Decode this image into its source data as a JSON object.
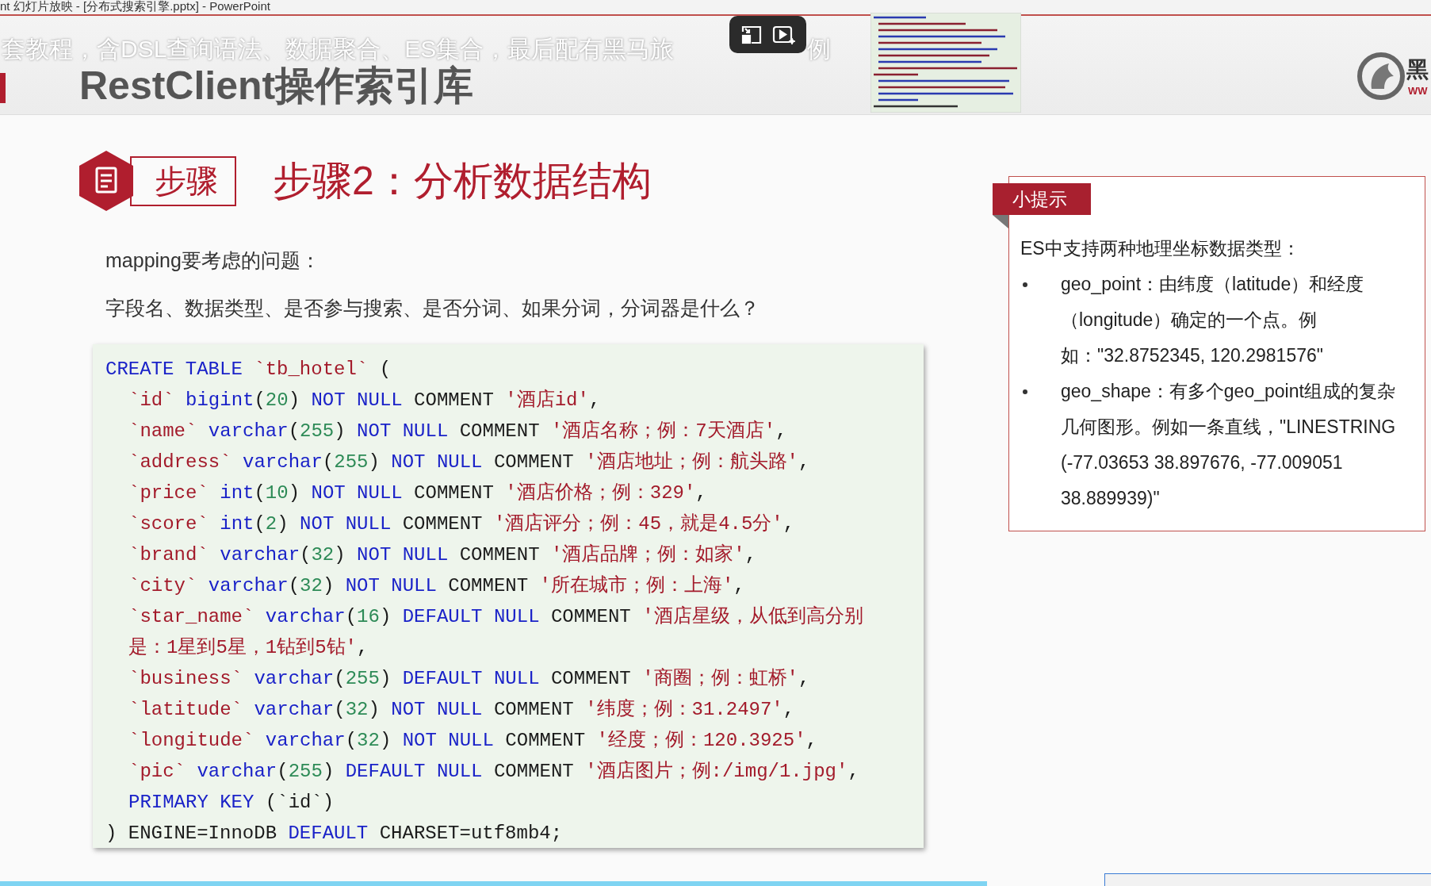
{
  "window": {
    "title": "nt 幻灯片放映 - [分布式搜索引擎.pptx] - PowerPoint"
  },
  "video_overlay": {
    "subtitle_before": "套教程，含DSL查询语法、数据聚合、ES集合，最后配有黑马旅",
    "subtitle_after": "例",
    "buttons": [
      {
        "kind": "pip"
      },
      {
        "kind": "play"
      }
    ]
  },
  "slide": {
    "title": "RestClient操作索引库",
    "logo_text": "黑",
    "logo_url": "WW",
    "step_label": "步骤",
    "heading": "步骤2：分析数据结构",
    "paragraphs": [
      "mapping要考虑的问题：",
      "字段名、数据类型、是否参与搜索、是否分词、如果分词，分词器是什么？"
    ],
    "code": [
      {
        "indent": false,
        "tokens": [
          {
            "kind": "kw",
            "text": "CREATE TABLE "
          },
          {
            "kind": "id",
            "text": "`tb_hotel`"
          },
          {
            "kind": "plain",
            "text": " ("
          }
        ]
      },
      {
        "indent": true,
        "tokens": [
          {
            "kind": "id",
            "text": "`id`"
          },
          {
            "kind": "kw",
            "text": "bigint"
          },
          {
            "kind": "plain",
            "text": "("
          },
          {
            "kind": "num",
            "text": "20"
          },
          {
            "kind": "plain",
            "text": ") "
          },
          {
            "kind": "kw",
            "text": "NOT NULL"
          },
          {
            "kind": "plain",
            "text": " COMMENT "
          },
          {
            "kind": "str",
            "text": "'酒店id'"
          },
          {
            "kind": "plain",
            "text": ","
          }
        ]
      },
      {
        "indent": true,
        "tokens": [
          {
            "kind": "id",
            "text": "`name`"
          },
          {
            "kind": "kw",
            "text": "varchar"
          },
          {
            "kind": "plain",
            "text": "("
          },
          {
            "kind": "num",
            "text": "255"
          },
          {
            "kind": "plain",
            "text": ") "
          },
          {
            "kind": "kw",
            "text": "NOT NULL"
          },
          {
            "kind": "plain",
            "text": " COMMENT "
          },
          {
            "kind": "str",
            "text": "'酒店名称；例：7天酒店'"
          },
          {
            "kind": "plain",
            "text": ","
          }
        ]
      },
      {
        "indent": true,
        "tokens": [
          {
            "kind": "id",
            "text": "`address`"
          },
          {
            "kind": "kw",
            "text": "varchar"
          },
          {
            "kind": "plain",
            "text": "("
          },
          {
            "kind": "num",
            "text": "255"
          },
          {
            "kind": "plain",
            "text": ") "
          },
          {
            "kind": "kw",
            "text": "NOT NULL"
          },
          {
            "kind": "plain",
            "text": " COMMENT "
          },
          {
            "kind": "str",
            "text": "'酒店地址；例：航头路'"
          },
          {
            "kind": "plain",
            "text": ","
          }
        ]
      },
      {
        "indent": true,
        "tokens": [
          {
            "kind": "id",
            "text": "`price`"
          },
          {
            "kind": "kw",
            "text": "int"
          },
          {
            "kind": "plain",
            "text": "("
          },
          {
            "kind": "num",
            "text": "10"
          },
          {
            "kind": "plain",
            "text": ") "
          },
          {
            "kind": "kw",
            "text": "NOT NULL"
          },
          {
            "kind": "plain",
            "text": " COMMENT "
          },
          {
            "kind": "str",
            "text": "'酒店价格；例：329'"
          },
          {
            "kind": "plain",
            "text": ","
          }
        ]
      },
      {
        "indent": true,
        "tokens": [
          {
            "kind": "id",
            "text": "`score`"
          },
          {
            "kind": "kw",
            "text": "int"
          },
          {
            "kind": "plain",
            "text": "("
          },
          {
            "kind": "num",
            "text": "2"
          },
          {
            "kind": "plain",
            "text": ") "
          },
          {
            "kind": "kw",
            "text": "NOT NULL"
          },
          {
            "kind": "plain",
            "text": " COMMENT "
          },
          {
            "kind": "str",
            "text": "'酒店评分；例：45，就是4.5分'"
          },
          {
            "kind": "plain",
            "text": ","
          }
        ]
      },
      {
        "indent": true,
        "tokens": [
          {
            "kind": "id",
            "text": "`brand`"
          },
          {
            "kind": "kw",
            "text": "varchar"
          },
          {
            "kind": "plain",
            "text": "("
          },
          {
            "kind": "num",
            "text": "32"
          },
          {
            "kind": "plain",
            "text": ") "
          },
          {
            "kind": "kw",
            "text": "NOT NULL"
          },
          {
            "kind": "plain",
            "text": " COMMENT "
          },
          {
            "kind": "str",
            "text": "'酒店品牌；例：如家'"
          },
          {
            "kind": "plain",
            "text": ","
          }
        ]
      },
      {
        "indent": true,
        "tokens": [
          {
            "kind": "id",
            "text": "`city`"
          },
          {
            "kind": "kw",
            "text": "varchar"
          },
          {
            "kind": "plain",
            "text": "("
          },
          {
            "kind": "num",
            "text": "32"
          },
          {
            "kind": "plain",
            "text": ") "
          },
          {
            "kind": "kw",
            "text": "NOT NULL"
          },
          {
            "kind": "plain",
            "text": " COMMENT "
          },
          {
            "kind": "str",
            "text": "'所在城市；例：上海'"
          },
          {
            "kind": "plain",
            "text": ","
          }
        ]
      },
      {
        "indent": true,
        "tokens": [
          {
            "kind": "id",
            "text": "`star_name`"
          },
          {
            "kind": "kw",
            "text": "varchar"
          },
          {
            "kind": "plain",
            "text": "("
          },
          {
            "kind": "num",
            "text": "16"
          },
          {
            "kind": "plain",
            "text": ") "
          },
          {
            "kind": "kw",
            "text": "DEFAULT NULL"
          },
          {
            "kind": "plain",
            "text": " COMMENT "
          },
          {
            "kind": "str",
            "text": "'酒店星级，从低到高分别是：1星到5星，1钻到5钻'"
          },
          {
            "kind": "plain",
            "text": ","
          }
        ]
      },
      {
        "indent": true,
        "tokens": [
          {
            "kind": "id",
            "text": "`business`"
          },
          {
            "kind": "kw",
            "text": "varchar"
          },
          {
            "kind": "plain",
            "text": "("
          },
          {
            "kind": "num",
            "text": "255"
          },
          {
            "kind": "plain",
            "text": ") "
          },
          {
            "kind": "kw",
            "text": "DEFAULT NULL"
          },
          {
            "kind": "plain",
            "text": " COMMENT "
          },
          {
            "kind": "str",
            "text": "'商圈；例：虹桥'"
          },
          {
            "kind": "plain",
            "text": ","
          }
        ]
      },
      {
        "indent": true,
        "tokens": [
          {
            "kind": "id",
            "text": "`latitude`"
          },
          {
            "kind": "kw",
            "text": "varchar"
          },
          {
            "kind": "plain",
            "text": "("
          },
          {
            "kind": "num",
            "text": "32"
          },
          {
            "kind": "plain",
            "text": ") "
          },
          {
            "kind": "kw",
            "text": "NOT NULL"
          },
          {
            "kind": "plain",
            "text": " COMMENT "
          },
          {
            "kind": "str",
            "text": "'纬度；例：31.2497'"
          },
          {
            "kind": "plain",
            "text": ","
          }
        ]
      },
      {
        "indent": true,
        "tokens": [
          {
            "kind": "id",
            "text": "`longitude`"
          },
          {
            "kind": "kw",
            "text": "varchar"
          },
          {
            "kind": "plain",
            "text": "("
          },
          {
            "kind": "num",
            "text": "32"
          },
          {
            "kind": "plain",
            "text": ") "
          },
          {
            "kind": "kw",
            "text": "NOT NULL"
          },
          {
            "kind": "plain",
            "text": " COMMENT "
          },
          {
            "kind": "str",
            "text": "'经度；例：120.3925'"
          },
          {
            "kind": "plain",
            "text": ","
          }
        ]
      },
      {
        "indent": true,
        "tokens": [
          {
            "kind": "id",
            "text": "`pic`"
          },
          {
            "kind": "kw",
            "text": "varchar"
          },
          {
            "kind": "plain",
            "text": "("
          },
          {
            "kind": "num",
            "text": "255"
          },
          {
            "kind": "plain",
            "text": ") "
          },
          {
            "kind": "kw",
            "text": "DEFAULT NULL"
          },
          {
            "kind": "plain",
            "text": " COMMENT "
          },
          {
            "kind": "str",
            "text": "'酒店图片；例:/img/1.jpg'"
          },
          {
            "kind": "plain",
            "text": ","
          }
        ]
      },
      {
        "indent": true,
        "tokens": [
          {
            "kind": "kw",
            "text": "PRIMARY KEY"
          },
          {
            "kind": "plain",
            "text": " (`id`)"
          }
        ]
      },
      {
        "indent": false,
        "tokens": [
          {
            "kind": "plain",
            "text": ") ENGINE=InnoDB "
          },
          {
            "kind": "kw",
            "text": "DEFAULT"
          },
          {
            "kind": "plain",
            "text": " CHARSET=utf8mb4;"
          }
        ]
      }
    ],
    "tip": {
      "label": "小提示",
      "intro": "ES中支持两种地理坐标数据类型：",
      "items": [
        "geo_point：由纬度（latitude）和经度（longitude）确定的一个点。例如：\"32.8752345, 120.2981576\"",
        "geo_shape：有多个geo_point组成的复杂几何图形。例如一条直线，\"LINESTRING (-77.03653 38.897676, -77.009051 38.889939)\""
      ]
    }
  },
  "progress": {
    "level": 0.69
  }
}
